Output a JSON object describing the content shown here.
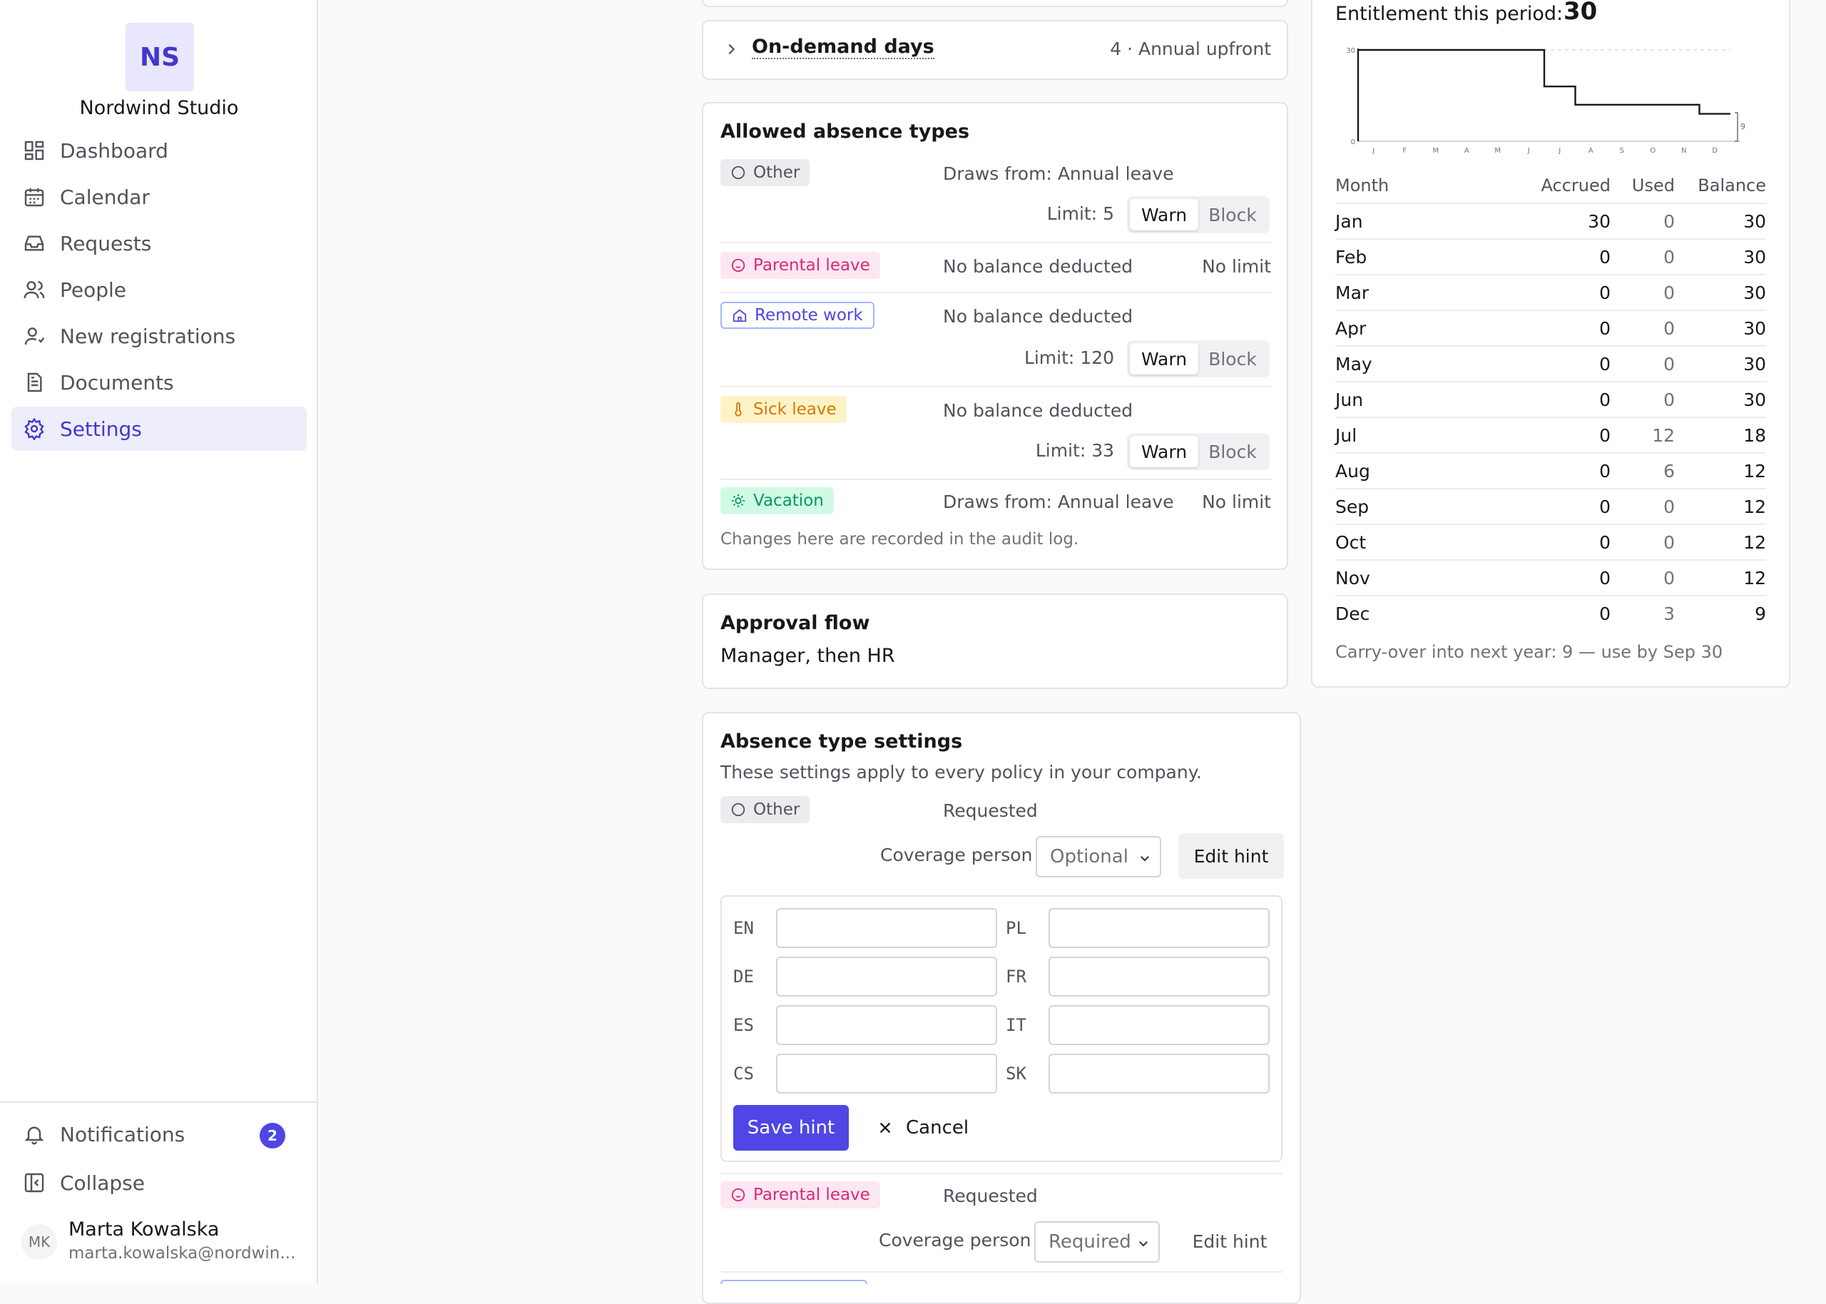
{
  "sidebar": {
    "org_initials": "NS",
    "org_name": "Nordwind Studio",
    "nav": [
      {
        "label": "Dashboard",
        "icon": "dashboard-icon"
      },
      {
        "label": "Calendar",
        "icon": "calendar-icon"
      },
      {
        "label": "Requests",
        "icon": "inbox-icon"
      },
      {
        "label": "People",
        "icon": "users-icon"
      },
      {
        "label": "New registrations",
        "icon": "user-plus-icon"
      },
      {
        "label": "Documents",
        "icon": "document-icon"
      },
      {
        "label": "Settings",
        "icon": "gear-icon",
        "active": true
      }
    ],
    "notifications_label": "Notifications",
    "notifications_count": "2",
    "collapse_label": "Collapse",
    "user": {
      "initials": "MK",
      "name": "Marta Kowalska",
      "email": "marta.kowalska@nordwin..."
    }
  },
  "on_demand": {
    "title": "On-demand days",
    "meta": "4 · Annual upfront"
  },
  "allowed_types": {
    "title": "Allowed absence types",
    "rows": [
      {
        "chip": "Other",
        "source": "Draws from: Annual leave",
        "limit": "Limit: 5",
        "mode": "Warn"
      },
      {
        "chip": "Parental leave",
        "source": "No balance deducted",
        "limit": "No limit"
      },
      {
        "chip": "Remote work",
        "source": "No balance deducted",
        "limit": "Limit: 120",
        "mode": "Warn"
      },
      {
        "chip": "Sick leave",
        "source": "No balance deducted",
        "limit": "Limit: 33",
        "mode": "Warn"
      },
      {
        "chip": "Vacation",
        "source": "Draws from: Annual leave",
        "limit": "No limit"
      }
    ],
    "warn_label": "Warn",
    "block_label": "Block",
    "footnote": "Changes here are recorded in the audit log."
  },
  "approval": {
    "title": "Approval flow",
    "value": "Manager, then HR"
  },
  "absence_settings": {
    "title": "Absence type settings",
    "subtitle": "These settings apply to every policy in your company.",
    "rows": [
      {
        "chip": "Other",
        "status": "Requested",
        "coverage_label": "Coverage person",
        "coverage_value": "Optional",
        "edit_hint": "Edit hint"
      },
      {
        "chip": "Parental leave",
        "status": "Requested",
        "coverage_label": "Coverage person",
        "coverage_value": "Required",
        "edit_hint": "Edit hint"
      }
    ],
    "hint_languages": [
      "EN",
      "PL",
      "DE",
      "FR",
      "ES",
      "IT",
      "CS",
      "SK"
    ],
    "save_hint": "Save hint",
    "cancel": "Cancel"
  },
  "entitlement": {
    "label": "Entitlement this period:",
    "value": "30",
    "columns": [
      "Month",
      "Accrued",
      "Used",
      "Balance"
    ],
    "rows": [
      {
        "month": "Jan",
        "accrued": "30",
        "used": "0",
        "balance": "30"
      },
      {
        "month": "Feb",
        "accrued": "0",
        "used": "0",
        "balance": "30"
      },
      {
        "month": "Mar",
        "accrued": "0",
        "used": "0",
        "balance": "30"
      },
      {
        "month": "Apr",
        "accrued": "0",
        "used": "0",
        "balance": "30"
      },
      {
        "month": "May",
        "accrued": "0",
        "used": "0",
        "balance": "30"
      },
      {
        "month": "Jun",
        "accrued": "0",
        "used": "0",
        "balance": "30"
      },
      {
        "month": "Jul",
        "accrued": "0",
        "used": "12",
        "balance": "18"
      },
      {
        "month": "Aug",
        "accrued": "0",
        "used": "6",
        "balance": "12"
      },
      {
        "month": "Sep",
        "accrued": "0",
        "used": "0",
        "balance": "12"
      },
      {
        "month": "Oct",
        "accrued": "0",
        "used": "0",
        "balance": "12"
      },
      {
        "month": "Nov",
        "accrued": "0",
        "used": "0",
        "balance": "12"
      },
      {
        "month": "Dec",
        "accrued": "0",
        "used": "3",
        "balance": "9"
      }
    ],
    "carry_over": "Carry-over into next year: 9 — use by Sep 30"
  },
  "chart_data": {
    "type": "line",
    "categories": [
      "J",
      "F",
      "M",
      "A",
      "M",
      "J",
      "J",
      "A",
      "S",
      "O",
      "N",
      "D"
    ],
    "series": [
      {
        "values": [
          30,
          30,
          30,
          30,
          30,
          30,
          18,
          12,
          12,
          12,
          12,
          9
        ]
      }
    ],
    "y_ticks": [
      "30",
      "0"
    ],
    "end_label": "9",
    "ylim": [
      0,
      30
    ]
  },
  "colors": {
    "accent": "#4f46e5",
    "active_bg": "#eeedfc"
  }
}
